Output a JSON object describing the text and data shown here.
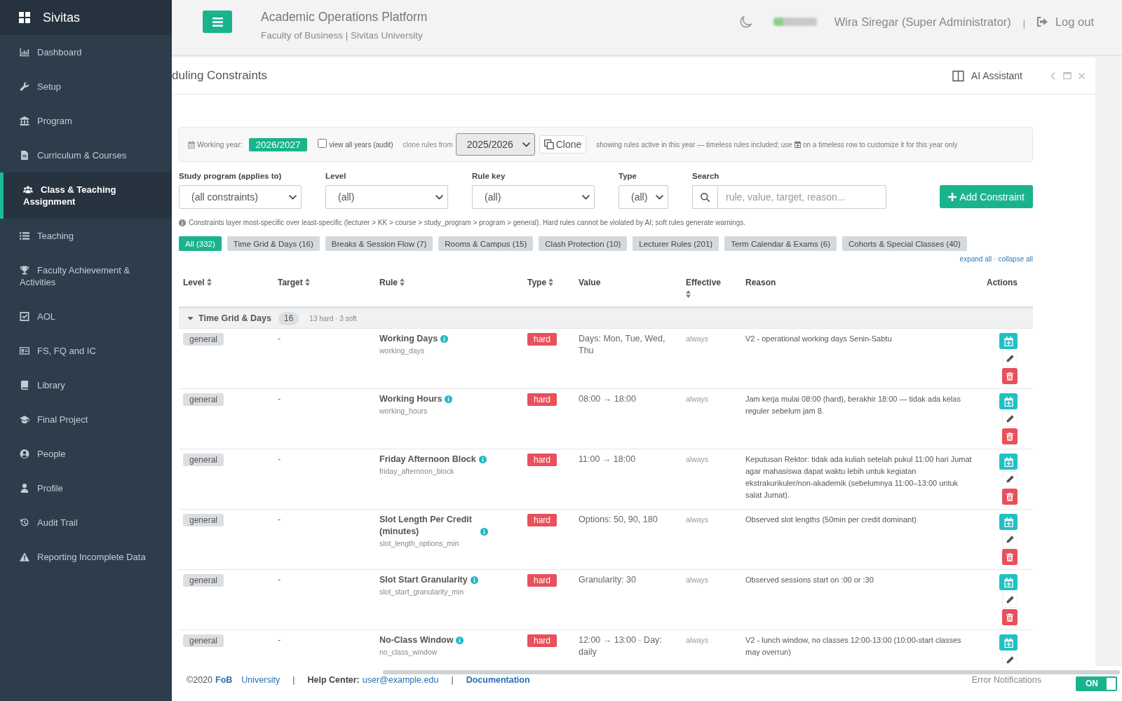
{
  "sidebar": {
    "brand": "Sivitas",
    "items": [
      {
        "label": "Dashboard",
        "selected": false
      },
      {
        "label": "Setup",
        "selected": false
      },
      {
        "label": "Program",
        "selected": false
      },
      {
        "label": "Curriculum & Courses",
        "selected": false
      },
      {
        "label": "Class & Teaching Assignment",
        "selected": true
      },
      {
        "label": "Teaching",
        "selected": false
      },
      {
        "label": "Faculty Achievement & Activities",
        "selected": false
      },
      {
        "label": "AOL",
        "selected": false
      },
      {
        "label": "FS, FQ and IC",
        "selected": false
      },
      {
        "label": "Library",
        "selected": false
      },
      {
        "label": "Final Project",
        "selected": false
      },
      {
        "label": "People",
        "selected": false
      },
      {
        "label": "Profile",
        "selected": false
      },
      {
        "label": "Audit Trail",
        "selected": false
      },
      {
        "label": "Reporting Incomplete Data",
        "selected": false
      }
    ]
  },
  "header": {
    "title": "Academic Operations Platform",
    "subtitle": "Faculty of Business | Sivitas University",
    "user": "Wira Siregar (Super Administrator)",
    "separator": "|",
    "logout": "Log out"
  },
  "panel": {
    "title": "duling Constraints",
    "assistant": "AI Assistant"
  },
  "year_bar": {
    "working_year_label": "Working year:",
    "working_year": "2026/2027",
    "view_all": {
      "label": "view all years (audit)",
      "checked": false
    },
    "clone_label": "clone rules from",
    "clone_from": "2025/2026",
    "clone_button": "Clone",
    "note_before": "showing rules active in this year — timeless rules included; use",
    "note_after": "on a timeless row to customize it for this year only"
  },
  "filters": [
    {
      "label": "Study program (applies to)",
      "kind": "select",
      "value": "(all constraints)"
    },
    {
      "label": "Level",
      "kind": "select",
      "value": "(all)"
    },
    {
      "label": "Rule key",
      "kind": "select",
      "value": "(all)"
    },
    {
      "label": "Type",
      "kind": "select",
      "value": "(all)"
    },
    {
      "label": "Search",
      "kind": "search",
      "placeholder": "rule, value, target, reason..."
    }
  ],
  "add_button": "Add Constraint",
  "info_note": "Constraints layer most-specific over least-specific (lecturer > KK > course > study_program > program > general). Hard rules cannot be violated by AI; soft rules generate warnings.",
  "categories": [
    {
      "label": "All (332)",
      "selected": true
    },
    {
      "label": "Time Grid & Days (16)",
      "selected": false
    },
    {
      "label": "Breaks & Session Flow (7)",
      "selected": false
    },
    {
      "label": "Rooms & Campus (15)",
      "selected": false
    },
    {
      "label": "Clash Protection (10)",
      "selected": false
    },
    {
      "label": "Lecturer Rules (201)",
      "selected": false
    },
    {
      "label": "Term Calendar & Exams (6)",
      "selected": false
    },
    {
      "label": "Cohorts & Special Classes (40)",
      "selected": false
    }
  ],
  "expand_links": {
    "expand": "expand all",
    "separator": "·",
    "collapse": "collapse all"
  },
  "table": {
    "columns": [
      {
        "label": "Level",
        "sortable": true
      },
      {
        "label": "Target",
        "sortable": true
      },
      {
        "label": "Rule",
        "sortable": true
      },
      {
        "label": "Type",
        "sortable": true
      },
      {
        "label": "Value",
        "sortable": false
      },
      {
        "label": "Effective",
        "sortable": true
      },
      {
        "label": "Reason",
        "sortable": false
      },
      {
        "label": "Actions",
        "sortable": false
      }
    ],
    "groups": [
      {
        "name": "Time Grid & Days",
        "count": "16",
        "summary": "13 hard · 3 soft",
        "expanded": true,
        "rows": [
          {
            "level": "general",
            "target": "-",
            "rule": "Working Days",
            "key": "working_days",
            "type": {
              "label": "hard",
              "kind": "hard"
            },
            "value": "Days: Mon, Tue, Wed, Thu",
            "effective": "always",
            "reason": "V2 - operational working days Senin-Sabtu"
          },
          {
            "level": "general",
            "target": "-",
            "rule": "Working Hours",
            "key": "working_hours",
            "type": {
              "label": "hard",
              "kind": "hard"
            },
            "value": "08:00 → 18:00",
            "effective": "always",
            "reason": "Jam kerja mulai 08:00 (hard), berakhir 18:00 — tidak ada kelas reguler sebelum jam 8."
          },
          {
            "level": "general",
            "target": "-",
            "rule": "Friday Afternoon Block",
            "key": "friday_afternoon_block",
            "type": {
              "label": "hard",
              "kind": "hard"
            },
            "value": "11:00 → 18:00",
            "effective": "always",
            "reason": "Keputusan Rektor: tidak ada kuliah setelah pukul 11:00 hari Jumat agar mahasiswa dapat waktu lebih untuk kegiatan ekstrakurikuler/non-akademik (sebelumnya 11:00–13:00 untuk salat Jumat)."
          },
          {
            "level": "general",
            "target": "-",
            "rule": "Slot Length Per Credit (minutes)",
            "key": "slot_length_options_min",
            "type": {
              "label": "hard",
              "kind": "hard"
            },
            "value": "Options: 50, 90, 180",
            "effective": "always",
            "reason": "Observed slot lengths (50min per credit dominant)"
          },
          {
            "level": "general",
            "target": "-",
            "rule": "Slot Start Granularity",
            "key": "slot_start_granularity_min",
            "type": {
              "label": "hard",
              "kind": "hard"
            },
            "value": "Granularity: 30",
            "effective": "always",
            "reason": "Observed sessions start on :00 or :30"
          },
          {
            "level": "general",
            "target": "-",
            "rule": "No-Class Window",
            "key": "no_class_window",
            "type": {
              "label": "hard",
              "kind": "hard"
            },
            "value": "12:00 → 13:00 · Day: daily",
            "effective": "always",
            "reason": "V2 - lunch window, no classes 12:00-13:00 (10:00-start classes may overrun)"
          }
        ]
      }
    ]
  },
  "footer": {
    "copyright": "©2020",
    "brand_link": "FoB",
    "university_link": "University",
    "separators": [
      "|",
      "|"
    ],
    "help_label": "Help Center:",
    "help_email": "user@example.edu",
    "docs_link": "Documentation",
    "notifications_label": "Error Notifications",
    "notifications_toggle": {
      "text": "ON",
      "on": true
    }
  }
}
